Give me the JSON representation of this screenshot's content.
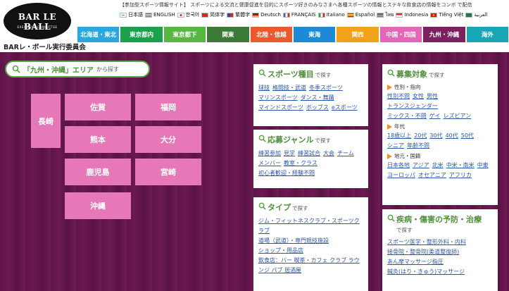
{
  "logo": {
    "text": "BAR LE BALL",
    "sub": "EXECUTIVE COMMITTEE"
  },
  "site_name": "BARレ・ボール実行委員会",
  "tagline": "【参加型スポーツ情報サイト】 スポーツによる交流と健康促進を目的にスポーツ好きのみなさまへ各種スポーツの情報とステキな飲食店の情報をコンボ で配信",
  "languages": [
    {
      "label": "日本語",
      "color": "#e33"
    },
    {
      "label": "ENGLISH",
      "color": "#335"
    },
    {
      "label": "한국어",
      "color": "#eee"
    },
    {
      "label": "简体字",
      "color": "#d22"
    },
    {
      "label": "繁體字",
      "color": "#34a"
    },
    {
      "label": "Deutsch",
      "color": "#222"
    },
    {
      "label": "FRANÇAIS",
      "color": "#36c"
    },
    {
      "label": "Italiano",
      "color": "#2a3"
    },
    {
      "label": "Español",
      "color": "#e90"
    },
    {
      "label": "ไทย",
      "color": "#a22"
    },
    {
      "label": "Indonesia",
      "color": "#e22"
    },
    {
      "label": "Tiếng Việt",
      "color": "#d11"
    },
    {
      "label": "العربية",
      "color": "#274"
    }
  ],
  "regions": [
    {
      "label": "北海道・東北",
      "color": "#2aa7de"
    },
    {
      "label": "東京都内",
      "color": "#1ba04b"
    },
    {
      "label": "東京都下",
      "color": "#57b742"
    },
    {
      "label": "関東",
      "color": "#3d7a38"
    },
    {
      "label": "北陸・信越",
      "color": "#ea5a2a"
    },
    {
      "label": "東海",
      "color": "#1e89d6"
    },
    {
      "label": "関西",
      "color": "#f0a31a"
    },
    {
      "label": "中国・四国",
      "color": "#e466b8"
    },
    {
      "label": "九州・沖縄",
      "color": "#7b2160"
    },
    {
      "label": "海外",
      "color": "#17a6b5"
    }
  ],
  "area_search": {
    "highlight": "「九州・沖縄」エリア",
    "tail": "から探す"
  },
  "prefectures": {
    "nagasaki": "長崎",
    "saga": "佐賀",
    "fukuoka": "福岡",
    "kumamoto": "熊本",
    "oita": "大分",
    "kagoshima": "鹿児島",
    "miyazaki": "宮崎",
    "okinawa": "沖縄"
  },
  "sports": {
    "title": "スポーツ種目",
    "tail": "で探す",
    "links": [
      "球技",
      "格闘技・武道",
      "冬季スポーツ",
      "マリンスポーツ",
      "ダンス・舞踊",
      "マインドスポーツ",
      "ボッブス",
      "eスポーツ"
    ]
  },
  "genre": {
    "title": "応募ジャンル",
    "tail": "で探す",
    "links": [
      "練習参加",
      "見学",
      "練習試合",
      "大会",
      "チーム",
      "メンバー",
      "教室・クラス",
      "初心者歓迎・経験不問"
    ]
  },
  "type": {
    "title": "タイプ",
    "tail": "で探す",
    "links": [
      "ジム・フィットネスクラブ・スポーツクラブ",
      "道場（武道）・専門競技施設",
      "ショップ・用品店",
      "飲食店：バー 喫茶・カフェ クラブ ラウンジ パブ 居酒屋"
    ]
  },
  "target": {
    "title": "募集対象",
    "tail": "で探す",
    "sections": [
      {
        "label": "性別・指向",
        "links": [
          "性別不問",
          "女性",
          "男性",
          "トランスジェンダー",
          "ミックス・不問",
          "ゲイ",
          "レズビアン"
        ]
      },
      {
        "label": "年代",
        "links": [
          "18歳以上",
          "20代",
          "30代",
          "40代",
          "50代",
          "シニア",
          "年齢不問"
        ]
      },
      {
        "label": "地元・国籍",
        "links": [
          "日本各地",
          "アジア",
          "北米",
          "中米・南米",
          "中東",
          "ヨーロッパ",
          "オセアニア",
          "アフリカ"
        ]
      }
    ]
  },
  "illness": {
    "title": "疾病・傷害の予防・治療",
    "tail": "で探す",
    "links": [
      "スポーツ医学・整形外科・内科",
      "接骨院・整骨院(柔道整復師)",
      "あん摩マッサージ指圧",
      "鍼灸(はり・きゅう)マッサージ"
    ]
  }
}
